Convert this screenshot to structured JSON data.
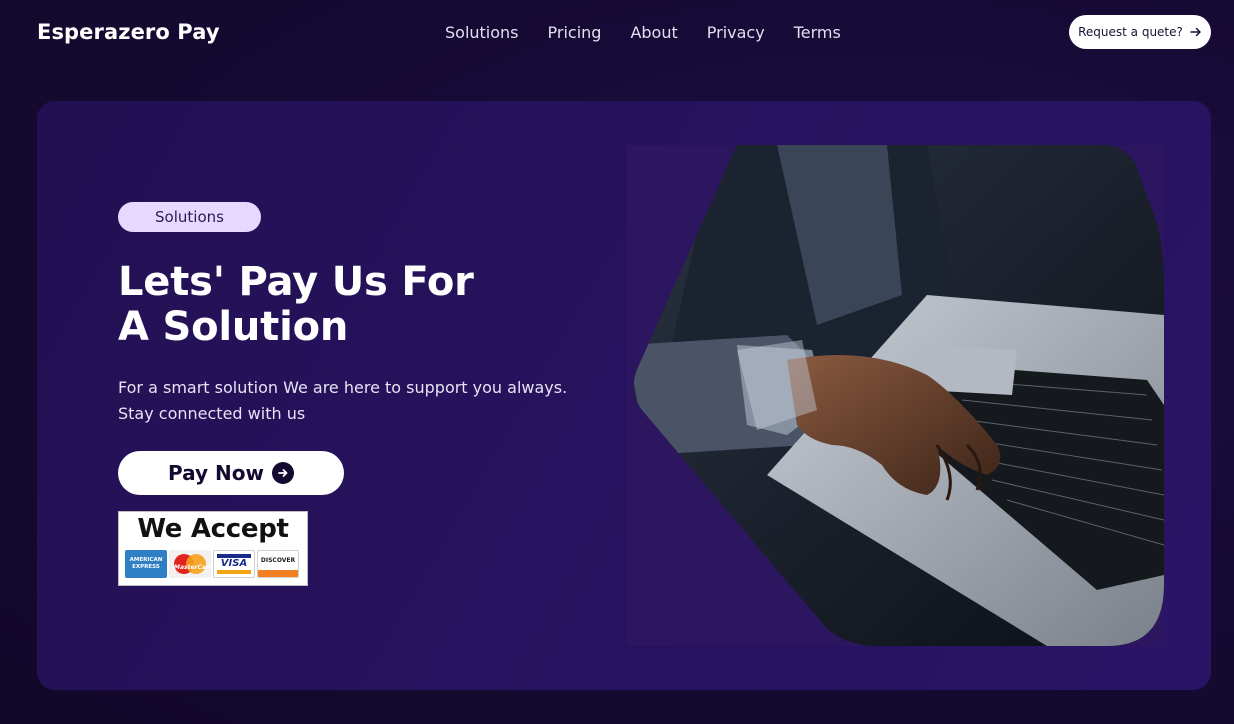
{
  "brand": "Esperazero Pay",
  "nav": [
    {
      "label": "Solutions"
    },
    {
      "label": "Pricing"
    },
    {
      "label": "About"
    },
    {
      "label": "Privacy"
    },
    {
      "label": "Terms"
    }
  ],
  "quote_button": {
    "label": "Request a quete?",
    "icon": "arrow-right-icon"
  },
  "hero": {
    "pill": "Solutions",
    "headline": [
      "Lets' Pay Us For",
      "A Solution"
    ],
    "subtext": [
      "For a smart solution We are here to support you always.",
      "Stay connected with us"
    ],
    "pay_button": {
      "label": "Pay Now",
      "icon": "arrow-circle-right-icon"
    },
    "accept": {
      "title": "We Accept",
      "cards": [
        "AMERICAN EXPRESS",
        "MasterCard",
        "VISA",
        "DISCOVER"
      ]
    },
    "image": {
      "subject": "person typing on a laptop"
    }
  },
  "colors": {
    "background": "#150a33",
    "card": "#26125d",
    "pill": "#e6d9ff",
    "button": "#ffffff"
  }
}
